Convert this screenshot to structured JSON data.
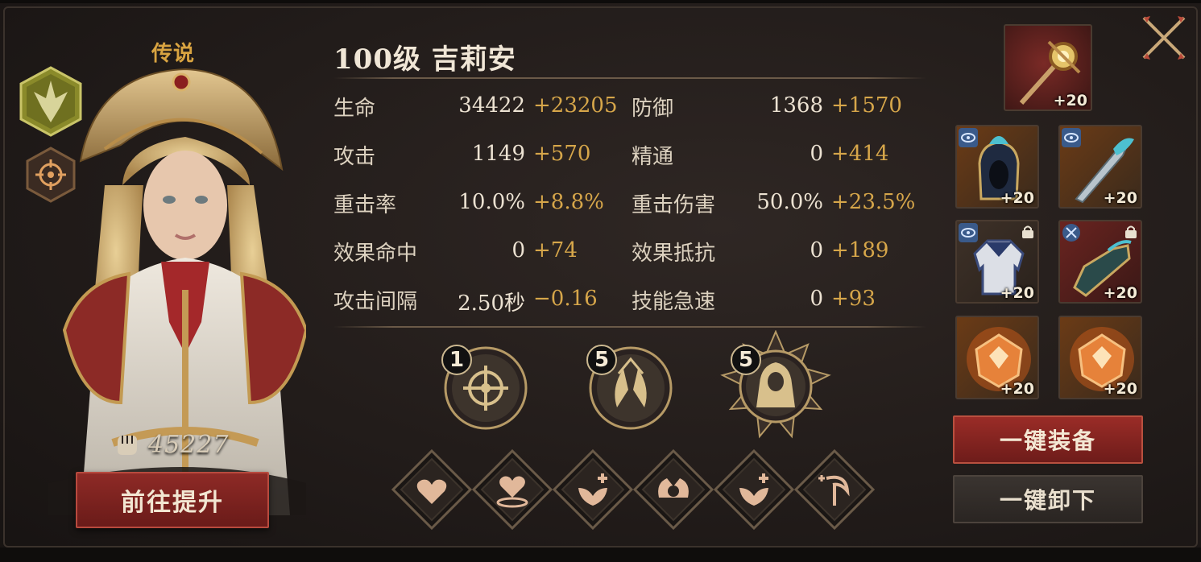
{
  "hero": {
    "rarity": "传说",
    "name": "100级  吉莉安",
    "power": "45227",
    "upgrade_label": "前往提升"
  },
  "stats": [
    {
      "label": "生命",
      "base": "34422",
      "bonus": "+23205"
    },
    {
      "label": "防御",
      "base": "1368",
      "bonus": "+1570"
    },
    {
      "label": "攻击",
      "base": "1149",
      "bonus": "+570"
    },
    {
      "label": "精通",
      "base": "0",
      "bonus": "+414"
    },
    {
      "label": "重击率",
      "base": "10.0%",
      "bonus": "+8.8%"
    },
    {
      "label": "重击伤害",
      "base": "50.0%",
      "bonus": "+23.5%"
    },
    {
      "label": "效果命中",
      "base": "0",
      "bonus": "+74"
    },
    {
      "label": "效果抵抗",
      "base": "0",
      "bonus": "+189"
    },
    {
      "label": "攻击间隔",
      "base": "2.50秒",
      "bonus": "−0.16"
    },
    {
      "label": "技能急速",
      "base": "0",
      "bonus": "+93"
    }
  ],
  "skills": [
    {
      "level": "1",
      "icon": "compass-sigil-icon"
    },
    {
      "level": "5",
      "icon": "praying-hands-icon"
    },
    {
      "level": "5",
      "icon": "hooded-figure-icon"
    }
  ],
  "runes": [
    {
      "icon": "heart-rune-icon"
    },
    {
      "icon": "heart-aura-rune-icon"
    },
    {
      "icon": "leaf-plus-rune-icon"
    },
    {
      "icon": "shield-hand-rune-icon"
    },
    {
      "icon": "leaf-plus-rune-icon"
    },
    {
      "icon": "sickle-rune-icon"
    }
  ],
  "equipment": {
    "weapon": {
      "level": "+20",
      "icon": "golden-scepter-icon"
    },
    "slots": [
      {
        "level": "+20",
        "icon": "helmet-icon",
        "badge": "eye-badge-icon",
        "locked": false
      },
      {
        "level": "+20",
        "icon": "dagger-icon",
        "badge": "eye-badge-icon",
        "locked": false
      },
      {
        "level": "+20",
        "icon": "armor-icon",
        "badge": "eye-badge-icon",
        "locked": true
      },
      {
        "level": "+20",
        "icon": "gauntlet-icon",
        "badge": "crossed-swords-badge-icon",
        "locked": true
      },
      {
        "level": "+20",
        "icon": "orange-gem-icon",
        "badge": "",
        "locked": false
      },
      {
        "level": "+20",
        "icon": "orange-gem-icon",
        "badge": "",
        "locked": false
      }
    ],
    "equip_all_label": "一键装备",
    "unequip_all_label": "一键卸下"
  },
  "colors": {
    "rarity": "#d9a441",
    "bonus": "#d6a64a",
    "primary_button": "#8e2a26",
    "secondary_button": "#332d29"
  }
}
